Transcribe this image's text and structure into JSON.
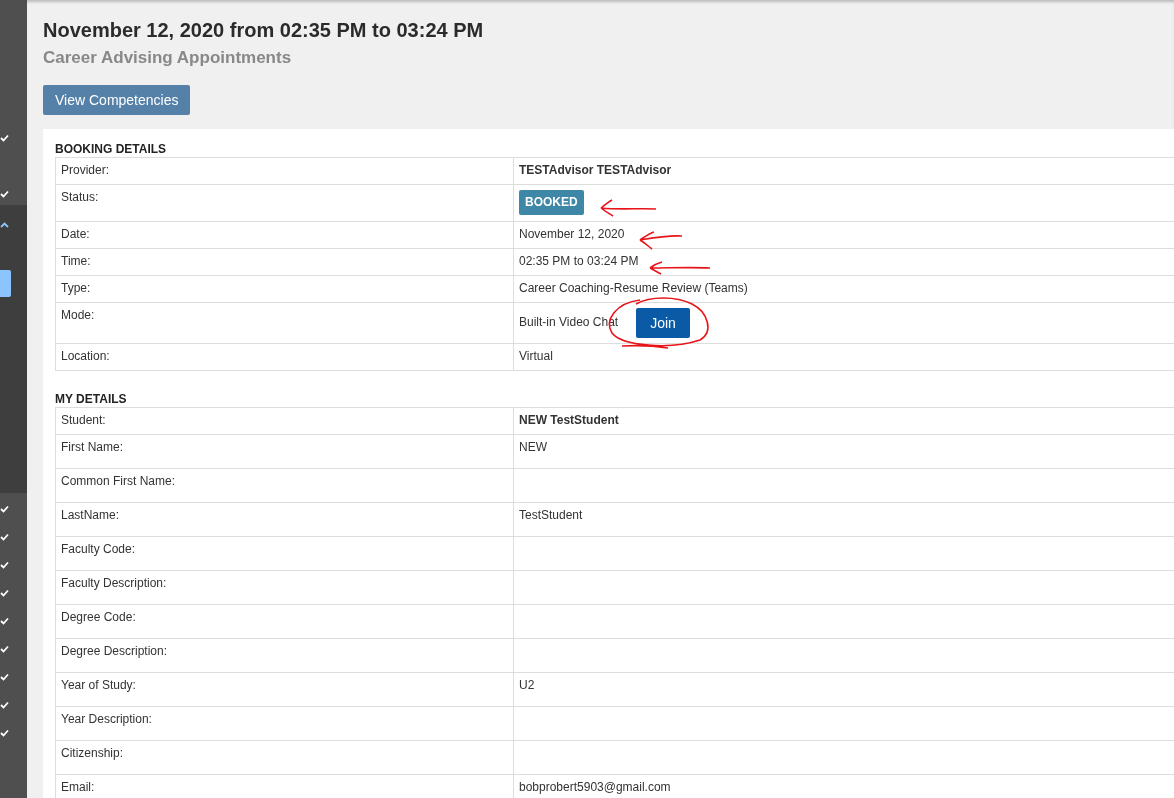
{
  "header": {
    "title": "November 12, 2020 from 02:35 PM to 03:24 PM",
    "subtitle": "Career Advising Appointments",
    "button": "View Competencies"
  },
  "sections": [
    {
      "heading": "BOOKING DETAILS",
      "rows": [
        {
          "label": "Provider:",
          "kind": "strong",
          "value": "TESTAdvisor TESTAdvisor"
        },
        {
          "label": "Status:",
          "kind": "badge",
          "value": "BOOKED"
        },
        {
          "label": "Date:",
          "kind": "text",
          "value": "November 12, 2020"
        },
        {
          "label": "Time:",
          "kind": "text",
          "value": "02:35 PM to 03:24 PM"
        },
        {
          "label": "Type:",
          "kind": "text",
          "value": "Career Coaching-Resume Review (Teams)"
        },
        {
          "label": "Mode:",
          "kind": "button",
          "value": "Built-in Video Chat",
          "button": "Join"
        },
        {
          "label": "Location:",
          "kind": "text",
          "value": "Virtual"
        }
      ]
    },
    {
      "heading": "MY DETAILS",
      "rows": [
        {
          "label": "Student:",
          "kind": "strong",
          "value": "NEW TestStudent"
        },
        {
          "label": "First Name:",
          "kind": "text",
          "value": "NEW"
        },
        {
          "label": "Common First Name:",
          "kind": "text"
        },
        {
          "label": "LastName:",
          "kind": "text",
          "value": "TestStudent"
        },
        {
          "label": "Faculty Code:",
          "kind": "text"
        },
        {
          "label": "Faculty Description:",
          "kind": "text"
        },
        {
          "label": "Degree Code:",
          "kind": "text"
        },
        {
          "label": "Degree Description:",
          "kind": "text"
        },
        {
          "label": "Year of Study:",
          "kind": "text",
          "value": "U2"
        },
        {
          "label": "Year Description:",
          "kind": "text"
        },
        {
          "label": "Citizenship:",
          "kind": "text"
        },
        {
          "label": "Email:",
          "kind": "text",
          "value": "bobprobert5903@gmail.com"
        }
      ]
    }
  ]
}
